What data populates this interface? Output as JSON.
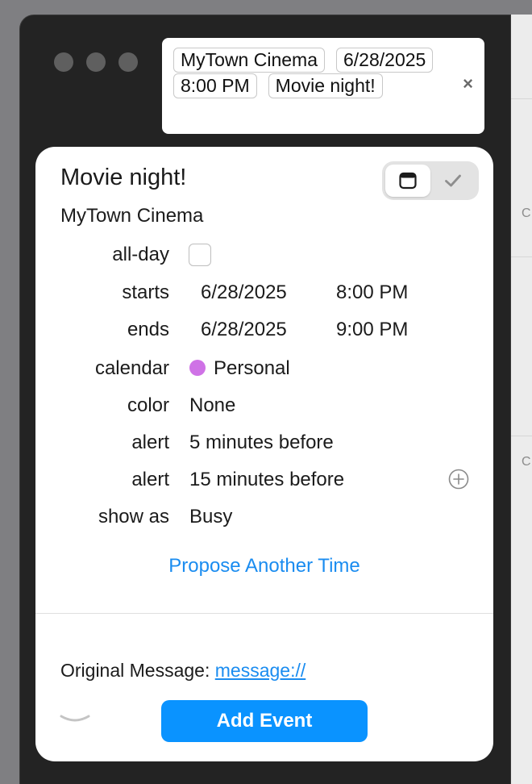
{
  "background": {
    "letters": [
      "C",
      "C"
    ]
  },
  "token_field": {
    "tokens": [
      "MyTown Cinema",
      "6/28/2025",
      "8:00 PM",
      "Movie night!"
    ],
    "clear_icon": "close-icon",
    "clear_glyph": "×"
  },
  "event": {
    "title": "Movie night!",
    "location": "MyTown Cinema"
  },
  "view_toggle": {
    "calendar_icon": "calendar-icon",
    "check_icon": "checkmark-icon"
  },
  "fields": {
    "all_day_label": "all-day",
    "starts_label": "starts",
    "starts_date": "6/28/2025",
    "starts_time": "8:00 PM",
    "ends_label": "ends",
    "ends_date": "6/28/2025",
    "ends_time": "9:00 PM",
    "calendar_label": "calendar",
    "calendar_value": "Personal",
    "calendar_color": "#cf72e6",
    "color_label": "color",
    "color_value": "None",
    "alert1_label": "alert",
    "alert1_value": "5 minutes before",
    "alert2_label": "alert",
    "alert2_value": "15 minutes before",
    "show_as_label": "show as",
    "show_as_value": "Busy"
  },
  "propose_label": "Propose Another Time",
  "original_message": {
    "label": "Original Message:",
    "link": "message://"
  },
  "add_button_label": "Add Event",
  "colors": {
    "accent": "#0a93ff",
    "link": "#1a8cf0",
    "window": "#232323"
  }
}
